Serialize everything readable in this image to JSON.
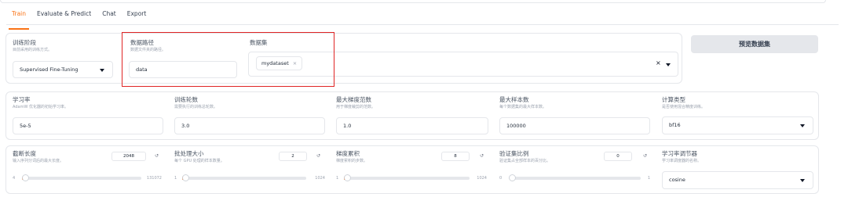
{
  "tabs": [
    {
      "label": "Train",
      "active": true
    },
    {
      "label": "Evaluate & Predict",
      "active": false
    },
    {
      "label": "Chat",
      "active": false
    },
    {
      "label": "Export",
      "active": false
    }
  ],
  "row1": {
    "training_stage": {
      "label": "训练阶段",
      "info": "目前采用的训练方式。",
      "value": "Supervised Fine-Tuning"
    },
    "data_dir": {
      "label": "数据路径",
      "info": "数据文件夹的路径。",
      "value": "data"
    },
    "dataset": {
      "label": "数据集",
      "chip": "mydataset",
      "chip_remove": "×",
      "clear": "×"
    },
    "preview_button": "预览数据集"
  },
  "row2": {
    "learning_rate": {
      "label": "学习率",
      "info": "AdamW 优化器的初始学习率。",
      "value": "5e-5"
    },
    "epochs": {
      "label": "训练轮数",
      "info": "需要执行的训练总轮数。",
      "value": "3.0"
    },
    "max_grad_norm": {
      "label": "最大梯度范数",
      "info": "用于梯度裁剪的范数。",
      "value": "1.0"
    },
    "max_samples": {
      "label": "最大样本数",
      "info": "每个数据集的最大样本数。",
      "value": "100000"
    },
    "compute_type": {
      "label": "计算类型",
      "info": "是否使用混合精度训练。",
      "value": "bf16"
    }
  },
  "row3": {
    "cutoff_len": {
      "label": "截断长度",
      "info": "输入序列分词后的最大长度。",
      "value": "2048",
      "min": "4",
      "max": "131072",
      "fraction": 0.0155
    },
    "batch_size": {
      "label": "批处理大小",
      "info": "每个 GPU 处理的样本数量。",
      "value": "2",
      "min": "1",
      "max": "1024",
      "fraction": 0.001
    },
    "grad_accum": {
      "label": "梯度累积",
      "info": "梯度累积的步数。",
      "value": "8",
      "min": "1",
      "max": "1024",
      "fraction": 0.007
    },
    "val_size": {
      "label": "验证集比例",
      "info": "验证集占全部样本的百分比。",
      "value": "0",
      "min": "0",
      "max": "1",
      "fraction": 0.0
    },
    "lr_scheduler": {
      "label": "学习率调节器",
      "info": "学习率调度器的名称。",
      "value": "cosine"
    },
    "reset_icon": "↺"
  },
  "colors": {
    "accent": "#f97316",
    "highlight": "#e02424"
  }
}
